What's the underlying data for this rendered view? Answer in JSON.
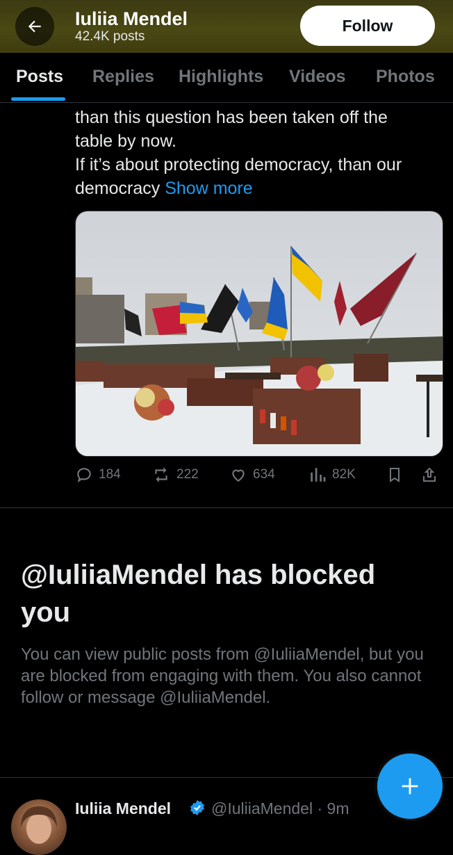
{
  "header": {
    "back_icon": "arrow-left-icon",
    "name": "Iuliia Mendel",
    "posts_count": "42.4K posts",
    "follow_label": "Follow",
    "accent": "#4a4813"
  },
  "tabs": [
    {
      "label": "Posts",
      "active": true
    },
    {
      "label": "Replies"
    },
    {
      "label": "Highlights"
    },
    {
      "label": "Videos"
    },
    {
      "label": "Photos"
    }
  ],
  "tweet": {
    "lines": [
      "than this question has been taken off the",
      "table by now.",
      "If it’s about protecting democracy, than our"
    ],
    "last_line_prefix": "democracy ",
    "show_more": "Show more",
    "image_alt_icon": "photo-cemetery-flags",
    "stats": {
      "replies": "184",
      "reposts": "222",
      "likes": "634",
      "views": "82K"
    }
  },
  "blocked": {
    "title": "@IuliiaMendel has blocked you",
    "body": "You can view public posts from @IuliiaMendel, but you are blocked from engaging with them. You also cannot follow or message @IuliiaMendel."
  },
  "next_tweet": {
    "name": "Iuliia Mendel",
    "handle_time": "@IuliiaMendel · 9m"
  },
  "fab_icon": "plus-icon",
  "colors": {
    "link": "#1d9bf0",
    "muted": "#71767b",
    "text": "#e7e9ea"
  }
}
